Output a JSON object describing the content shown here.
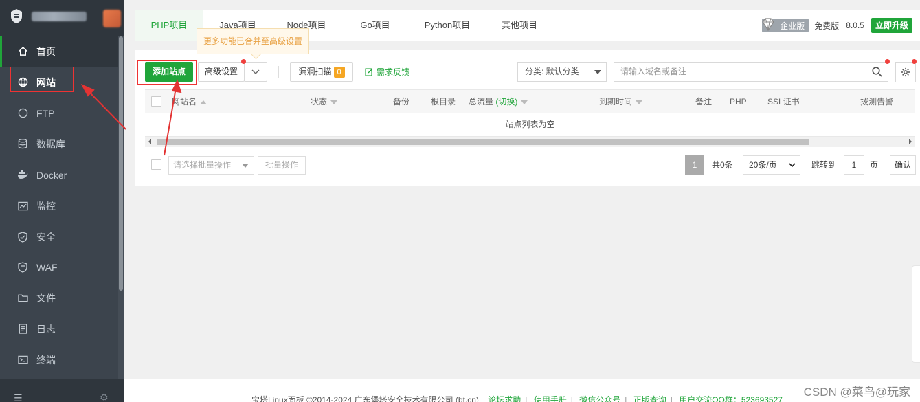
{
  "sidebar": {
    "items": [
      {
        "label": "首页",
        "icon": "home-icon"
      },
      {
        "label": "网站",
        "icon": "globe-icon"
      },
      {
        "label": "FTP",
        "icon": "ftp-icon"
      },
      {
        "label": "数据库",
        "icon": "database-icon"
      },
      {
        "label": "Docker",
        "icon": "docker-icon"
      },
      {
        "label": "监控",
        "icon": "monitor-icon"
      },
      {
        "label": "安全",
        "icon": "shield-icon"
      },
      {
        "label": "WAF",
        "icon": "waf-shield-icon"
      },
      {
        "label": "文件",
        "icon": "folder-icon"
      },
      {
        "label": "日志",
        "icon": "log-icon"
      },
      {
        "label": "终端",
        "icon": "terminal-icon"
      }
    ],
    "footer_left": "☰",
    "footer_right": "⚙"
  },
  "tabs": [
    "PHP项目",
    "Java项目",
    "Node项目",
    "Go项目",
    "Python项目",
    "其他项目"
  ],
  "header": {
    "edition": "企业版",
    "free": "免费版",
    "version": "8.0.5",
    "upgrade": "立即升级"
  },
  "tooltip": "更多功能已合并至高级设置",
  "toolbar": {
    "add_site": "添加站点",
    "advanced": "高级设置",
    "scan": "漏洞扫描",
    "scan_count": "0",
    "feedback": "需求反馈",
    "category": "分类: 默认分类",
    "search_placeholder": "请输入域名或备注"
  },
  "table": {
    "headers": {
      "name": "网站名",
      "status": "状态",
      "backup": "备份",
      "root": "根目录",
      "traffic": "总流量",
      "traffic_switch": "(切换)",
      "expire": "到期时间",
      "remark": "备注",
      "php": "PHP",
      "ssl": "SSL证书",
      "alert": "拨测告警"
    },
    "empty": "站点列表为空"
  },
  "footer_bar": {
    "batch_placeholder": "请选择批量操作",
    "batch_button": "批量操作",
    "current_page": "1",
    "total": "共0条",
    "page_size": "20条/页",
    "jump_label": "跳转到",
    "jump_value": "1",
    "page_unit": "页",
    "confirm": "确认"
  },
  "copyright": {
    "text": "宝塔Linux面板 ©2014-2024 广东堡塔安全技术有限公司 (bt.cn)",
    "links": [
      "论坛求助",
      "使用手册",
      "微信公众号",
      "正版查询",
      "用户交流QQ群：523693527"
    ]
  },
  "watermark": "CSDN @菜鸟@玩家",
  "colors": {
    "accent": "#20a53a",
    "sidebar": "#3c444d",
    "annotation": "#e33333"
  }
}
